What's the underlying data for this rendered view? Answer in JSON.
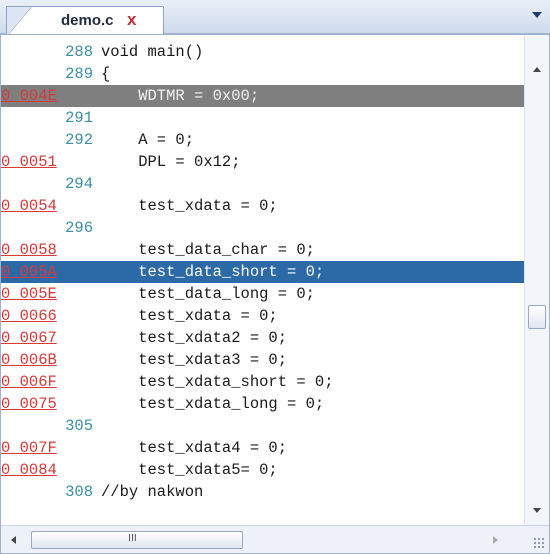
{
  "tab": {
    "label": "demo.c",
    "close": "x"
  },
  "hscroll": {
    "grip": "III"
  },
  "lines": [
    {
      "gutter": "288",
      "kind": "number",
      "code": "void main()"
    },
    {
      "gutter": "289",
      "kind": "number",
      "code": "{"
    },
    {
      "gutter": "0_004E",
      "kind": "addr",
      "code": "    WDTMR = 0x00;",
      "highlight": "current"
    },
    {
      "gutter": "291",
      "kind": "number",
      "code": ""
    },
    {
      "gutter": "292",
      "kind": "number",
      "code": "    A = 0;"
    },
    {
      "gutter": "0_0051",
      "kind": "addr",
      "code": "    DPL = 0x12;"
    },
    {
      "gutter": "294",
      "kind": "number",
      "code": ""
    },
    {
      "gutter": "0_0054",
      "kind": "addr",
      "code": "    test_xdata = 0;"
    },
    {
      "gutter": "296",
      "kind": "number",
      "code": ""
    },
    {
      "gutter": "0_0058",
      "kind": "addr",
      "code": "    test_data_char = 0;"
    },
    {
      "gutter": "0_005A",
      "kind": "addr",
      "code": "    test_data_short = 0;",
      "highlight": "select"
    },
    {
      "gutter": "0_005E",
      "kind": "addr",
      "code": "    test_data_long = 0;"
    },
    {
      "gutter": "0_0066",
      "kind": "addr",
      "code": "    test_xdata = 0;"
    },
    {
      "gutter": "0_0067",
      "kind": "addr",
      "code": "    test_xdata2 = 0;"
    },
    {
      "gutter": "0_006B",
      "kind": "addr",
      "code": "    test_xdata3 = 0;"
    },
    {
      "gutter": "0_006F",
      "kind": "addr",
      "code": "    test_xdata_short = 0;"
    },
    {
      "gutter": "0_0075",
      "kind": "addr",
      "code": "    test_xdata_long = 0;"
    },
    {
      "gutter": "305",
      "kind": "number",
      "code": ""
    },
    {
      "gutter": "0_007F",
      "kind": "addr",
      "code": "    test_xdata4 = 0;"
    },
    {
      "gutter": "0_0084",
      "kind": "addr",
      "code": "    test_xdata5= 0;"
    },
    {
      "gutter": "308",
      "kind": "number",
      "code": "//by nakwon"
    }
  ]
}
